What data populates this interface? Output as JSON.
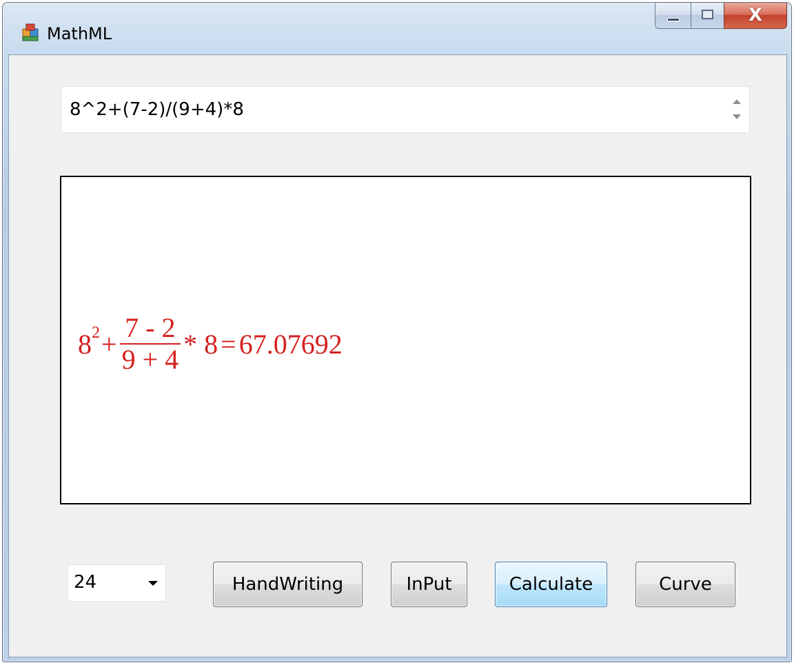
{
  "window": {
    "title": "MathML",
    "close_glyph": "X",
    "icons": [
      "app-icon",
      "minimize-icon",
      "maximize-icon",
      "close-icon"
    ]
  },
  "expression_input": {
    "value": "8^2+(7-2)/(9+4)*8"
  },
  "display": {
    "base": "8",
    "exponent": "2",
    "plus": "+",
    "numerator": "7 - 2",
    "denominator": "9 + 4",
    "times": "* 8",
    "equals": "=",
    "result": "67.07692",
    "color": "#d4201f"
  },
  "controls": {
    "font_size": "24",
    "handwriting_label": "HandWriting",
    "input_label": "InPut",
    "calculate_label": "Calculate",
    "curve_label": "Curve"
  }
}
